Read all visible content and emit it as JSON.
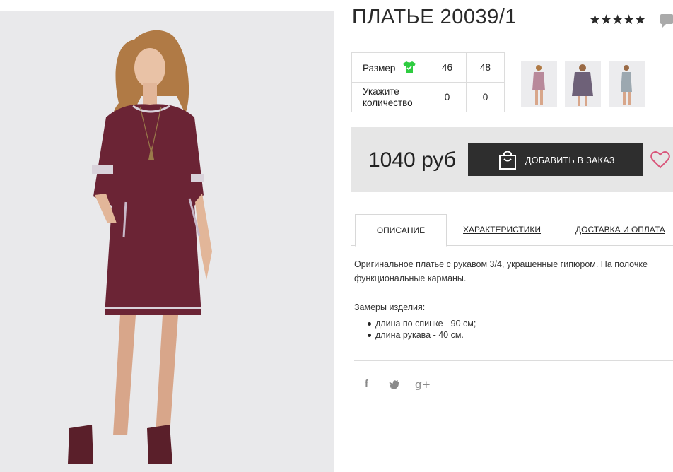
{
  "product": {
    "title": "ПЛАТЬЕ 20039/1",
    "rating": "★★★★★"
  },
  "sizes": {
    "size_label": "Размер",
    "qty_label": "Укажите количество",
    "values": [
      "46",
      "48"
    ],
    "quantities": [
      "0",
      "0"
    ]
  },
  "buy": {
    "price": "1040 руб",
    "add_label": "ДОБАВИТЬ В ЗАКАЗ"
  },
  "tabs": {
    "description": "ОПИСАНИЕ",
    "characteristics": "ХАРАКТЕРИСТИКИ",
    "delivery": "ДОСТАВКА И ОПЛАТА"
  },
  "description": {
    "text": "Оригинальное платье с рукавом 3/4, украшенные гипюром. На полочке функциональные карманы.",
    "measures_title": "Замеры изделия:",
    "measures": [
      "длина по спинке - 90 см;",
      "длина рукава - 40 см."
    ]
  },
  "social": {
    "facebook": "f",
    "twitter": "t",
    "google": "g+"
  },
  "colors": {
    "dress": "#6b2435",
    "button": "#2e2e2e",
    "buybox": "#e6e6e6",
    "shirt_icon": "#2ecc40",
    "heart": "#d9557a"
  }
}
